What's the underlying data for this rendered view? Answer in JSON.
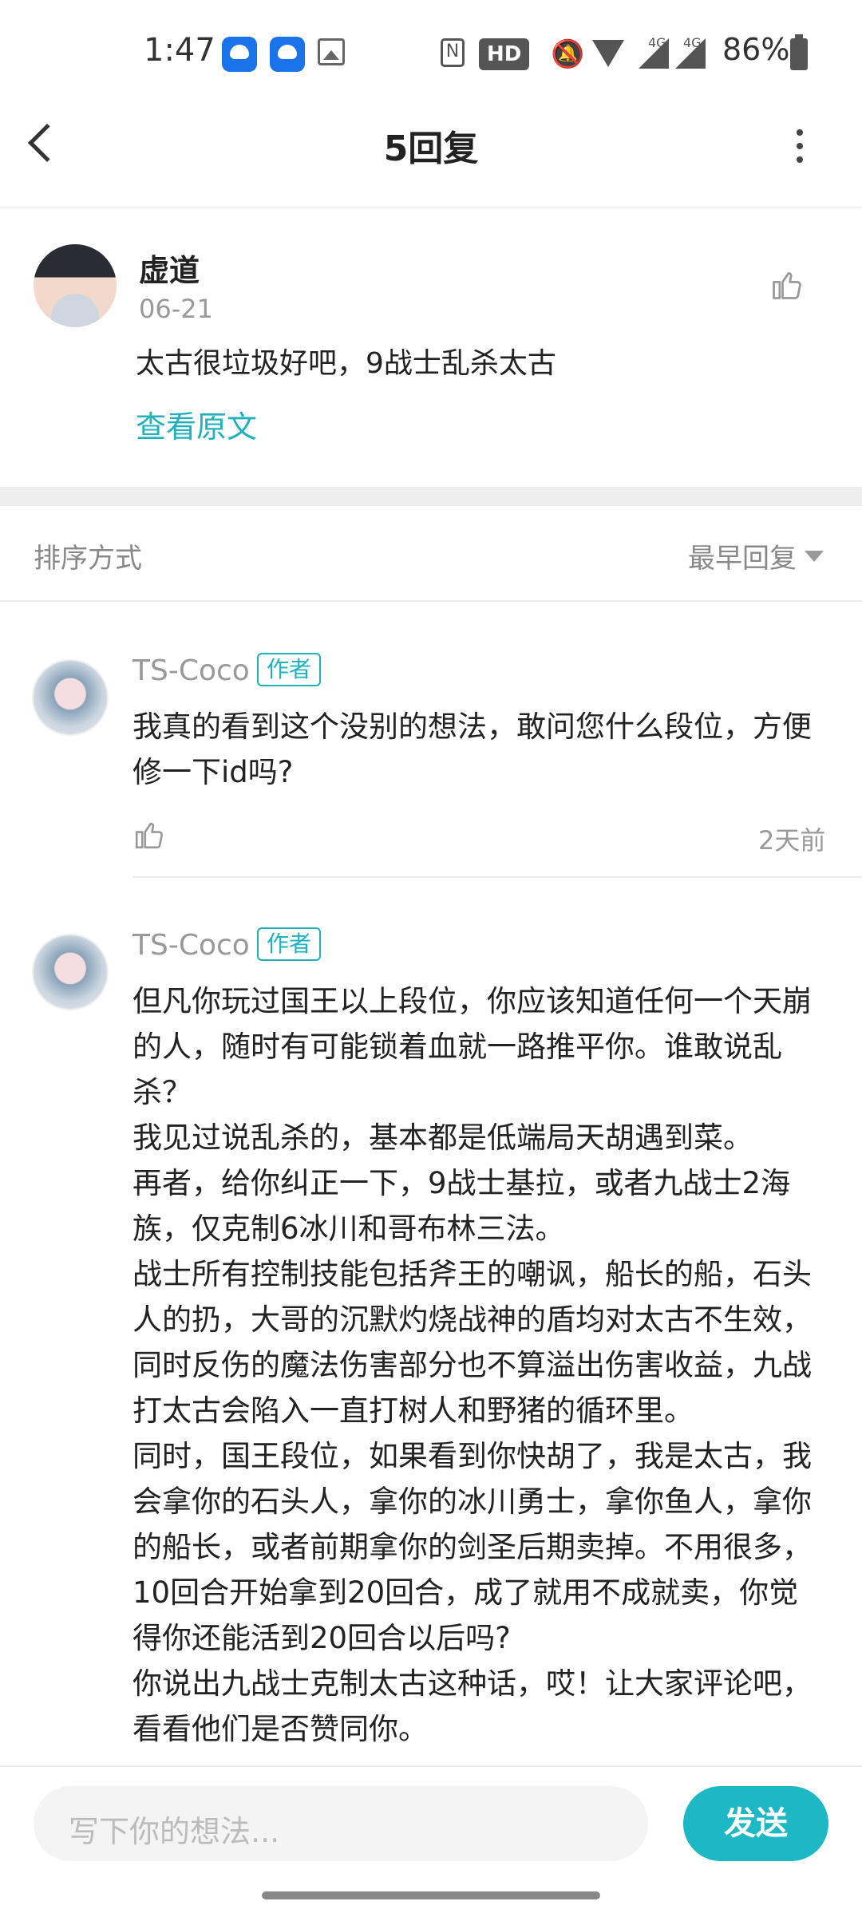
{
  "status_bar": {
    "time": "1:47",
    "hd_label": "HD",
    "network_1": "4G",
    "network_2": "4G",
    "battery": "86%"
  },
  "header": {
    "title": "5回复"
  },
  "original_post": {
    "author": "虚道",
    "date": "06-21",
    "text": "太古很垃圾好吧，9战士乱杀太古",
    "view_original": "查看原文"
  },
  "sort": {
    "label": "排序方式",
    "value": "最早回复"
  },
  "replies": [
    {
      "author": "TS-Coco",
      "badge": "作者",
      "text": "我真的看到这个没别的想法，敢问您什么段位，方便修一下id吗?",
      "time": "2天前"
    },
    {
      "author": "TS-Coco",
      "badge": "作者",
      "text": "但凡你玩过国王以上段位，你应该知道任何一个天崩的人，随时有可能锁着血就一路推平你。谁敢说乱杀？\n我见过说乱杀的，基本都是低端局天胡遇到菜。\n再者，给你纠正一下，9战士基拉，或者九战士2海族，仅克制6冰川和哥布林三法。\n战士所有控制技能包括斧王的嘲讽，船长的船，石头人的扔，大哥的沉默灼烧战神的盾均对太古不生效，同时反伤的魔法伤害部分也不算溢出伤害收益，九战打太古会陷入一直打树人和野猪的循环里。\n同时，国王段位，如果看到你快胡了，我是太古，我会拿你的石头人，拿你的冰川勇士，拿你鱼人，拿你的船长，或者前期拿你的剑圣后期卖掉。不用很多，10回合开始拿到20回合，成了就用不成就卖，你觉得你还能活到20回合以后吗?\n你说出九战士克制太古这种话，哎！让大家评论吧，看看他们是否赞同你。"
    }
  ],
  "composer": {
    "placeholder": "写下你的想法...",
    "send_label": "发送"
  },
  "colors": {
    "accent": "#1db8c4"
  }
}
